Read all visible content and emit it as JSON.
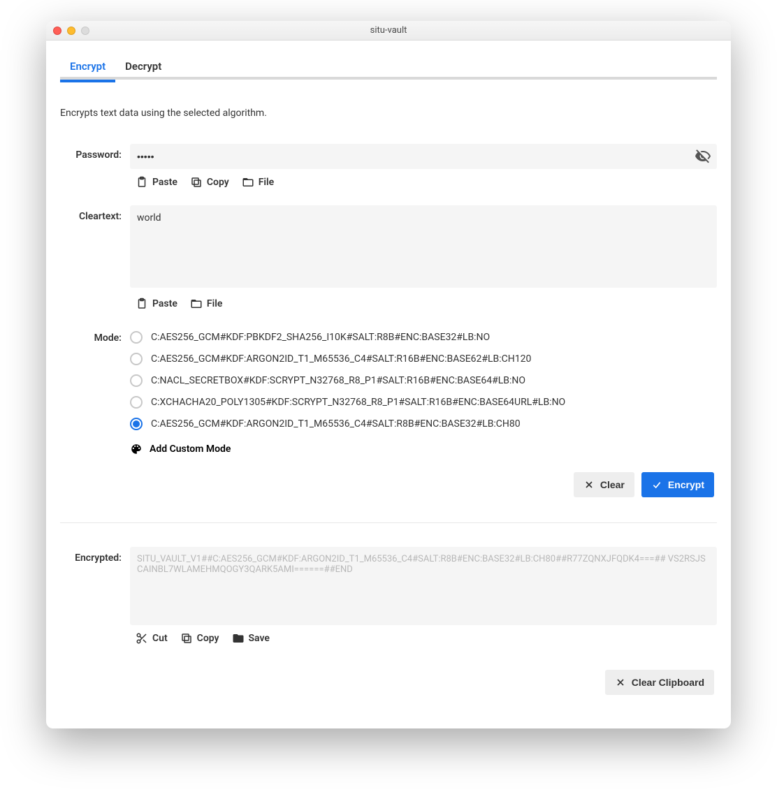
{
  "window": {
    "title": "situ-vault"
  },
  "tabs": {
    "encrypt": "Encrypt",
    "decrypt": "Decrypt",
    "active": "encrypt"
  },
  "description": "Encrypts text data using the selected algorithm.",
  "labels": {
    "password": "Password:",
    "cleartext": "Cleartext:",
    "mode": "Mode:",
    "encrypted": "Encrypted:"
  },
  "password": {
    "value": "•••••"
  },
  "cleartext": {
    "value": "world"
  },
  "toolbar": {
    "paste": "Paste",
    "copy": "Copy",
    "file": "File",
    "cut": "Cut",
    "save": "Save"
  },
  "modes": {
    "options": [
      "C:AES256_GCM#KDF:PBKDF2_SHA256_I10K#SALT:R8B#ENC:BASE32#LB:NO",
      "C:AES256_GCM#KDF:ARGON2ID_T1_M65536_C4#SALT:R16B#ENC:BASE62#LB:CH120",
      "C:NACL_SECRETBOX#KDF:SCRYPT_N32768_R8_P1#SALT:R16B#ENC:BASE64#LB:NO",
      "C:XCHACHA20_POLY1305#KDF:SCRYPT_N32768_R8_P1#SALT:R16B#ENC:BASE64URL#LB:NO",
      "C:AES256_GCM#KDF:ARGON2ID_T1_M65536_C4#SALT:R8B#ENC:BASE32#LB:CH80"
    ],
    "selected_index": 4,
    "add_custom": "Add Custom Mode"
  },
  "actions": {
    "clear": "Clear",
    "encrypt": "Encrypt",
    "clear_clipboard": "Clear Clipboard"
  },
  "encrypted": {
    "value": "SITU_VAULT_V1##C:AES256_GCM#KDF:ARGON2ID_T1_M65536_C4#SALT:R8B#ENC:BASE32#LB:CH80##R77ZQNXJFQDK4===## VS2RSJSCAINBL7WLAMEHMQOGY3QARK5AMI======##END"
  }
}
